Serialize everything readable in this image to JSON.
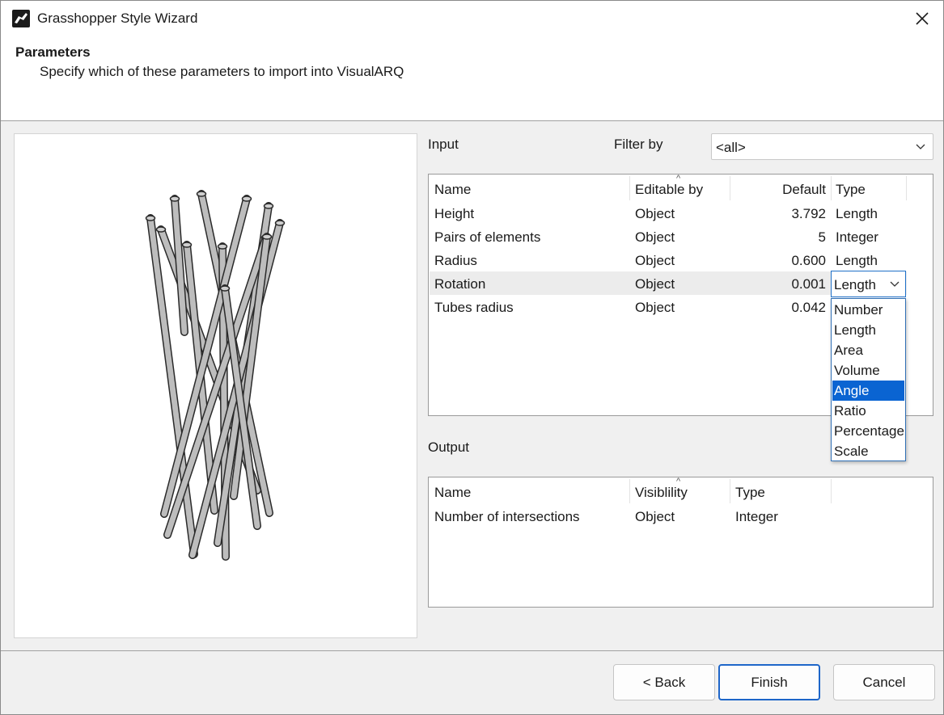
{
  "window": {
    "title": "Grasshopper Style Wizard"
  },
  "header": {
    "title": "Parameters",
    "subtitle": "Specify which of these parameters to import into VisualARQ"
  },
  "input": {
    "label": "Input",
    "filter_label": "Filter by",
    "filter_value": "<all>",
    "columns": [
      "Name",
      "Editable by",
      "Default",
      "Type"
    ],
    "rows": [
      {
        "name": "Height",
        "editable": "Object",
        "default": "3.792",
        "type": "Length"
      },
      {
        "name": "Pairs of elements",
        "editable": "Object",
        "default": "5",
        "type": "Integer"
      },
      {
        "name": "Radius",
        "editable": "Object",
        "default": "0.600",
        "type": "Length"
      },
      {
        "name": "Rotation",
        "editable": "Object",
        "default": "0.001",
        "type": "Length"
      },
      {
        "name": "Tubes radius",
        "editable": "Object",
        "default": "0.042",
        "type": ""
      }
    ],
    "selected_row": "Rotation",
    "type_dropdown": {
      "value": "Length",
      "options": [
        "Number",
        "Length",
        "Area",
        "Volume",
        "Angle",
        "Ratio",
        "Percentage",
        "Scale"
      ],
      "highlighted": "Angle"
    }
  },
  "output": {
    "label": "Output",
    "columns": [
      "Name",
      "Visiblility",
      "Type"
    ],
    "rows": [
      {
        "name": "Number of intersections",
        "visibility": "Object",
        "type": "Integer"
      }
    ]
  },
  "buttons": {
    "back": "< Back",
    "finish": "Finish",
    "cancel": "Cancel"
  },
  "colors": {
    "accent": "#0a64d2",
    "selected_row": "#ececec",
    "dialog_bg": "#f0f0f0"
  }
}
